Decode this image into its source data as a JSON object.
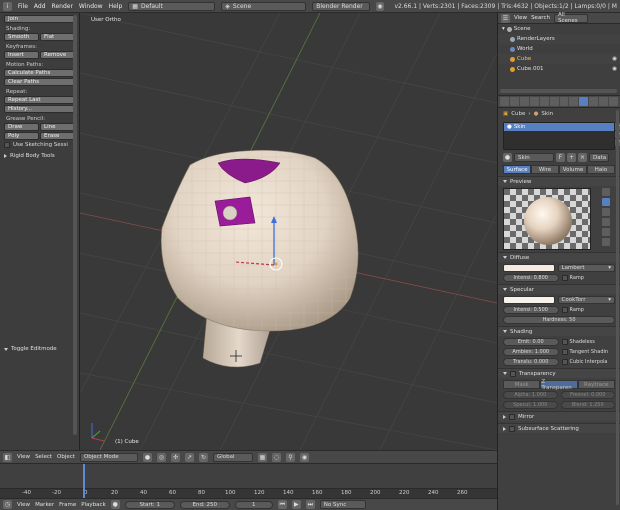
{
  "topbar": {
    "menus": [
      "File",
      "Add",
      "Render",
      "Window",
      "Help"
    ],
    "screen_layout": "Default",
    "scene": "Scene",
    "engine": "Blender Render",
    "stats": "v2.66.1 | Verts:2301 | Faces:2309 | Tris:4632 | Objects:1/2 | Lamps:0/0 | M"
  },
  "tools": {
    "join_label": "Join",
    "shading_title": "Shading:",
    "smooth_label": "Smooth",
    "flat_label": "Flat",
    "keyframes_title": "Keyframes:",
    "insert_label": "Insert",
    "remove_label": "Remove",
    "motion_title": "Motion Paths:",
    "calc_paths_label": "Calculate Paths",
    "clear_paths_label": "Clear Paths",
    "repeat_title": "Repeat:",
    "repeat_last_label": "Repeat Last",
    "history_label": "History...",
    "grease_title": "Grease Pencil:",
    "draw_label": "Draw",
    "line_label": "Line",
    "poly_label": "Poly",
    "erase_label": "Erase",
    "sketching_label": "Use Sketching Sessi",
    "rigid_body_label": "Rigid Body Tools",
    "toggle_editmode_label": "Toggle Editmode"
  },
  "viewport": {
    "view_label": "User Ortho",
    "object_label": "(1) Cube"
  },
  "vp_header": {
    "view": "View",
    "select": "Select",
    "object": "Object",
    "mode": "Object Mode",
    "orientation": "Global"
  },
  "timeline": {
    "ticks": [
      "-40",
      "-20",
      "0",
      "20",
      "40",
      "60",
      "80",
      "100",
      "120",
      "140",
      "160",
      "180",
      "200",
      "220",
      "240",
      "260"
    ],
    "header": {
      "view": "View",
      "marker": "Marker",
      "frame": "Frame",
      "playback": "Playback",
      "start": "Start: 1",
      "end": "End: 250",
      "current": "1",
      "sync": "No Sync"
    }
  },
  "outliner": {
    "view": "View",
    "search": "Search",
    "filter": "All Scenes",
    "rows": [
      "Scene",
      "RenderLayers",
      "World",
      "Cube",
      "Cube.001"
    ]
  },
  "properties": {
    "path_object": "Cube",
    "path_material": "Skin",
    "slot_name": "Skin",
    "material_name": "Skin",
    "material_users": "F",
    "data_label": "Data",
    "tabs": [
      "Surface",
      "Wire",
      "Volume",
      "Halo"
    ],
    "preview_title": "Preview",
    "diffuse": {
      "title": "Diffuse",
      "shader": "Lambert",
      "intensity": "Intensi: 0.800",
      "ramp": "Ramp",
      "color": "#f5ebe0"
    },
    "specular": {
      "title": "Specular",
      "shader": "CookTorr",
      "intensity": "Intensi: 0.500",
      "ramp": "Ramp",
      "hardness": "Hardness: 50",
      "color": "#f7f3ea"
    },
    "shading": {
      "title": "Shading",
      "emit": "Emit: 0.00",
      "ambient": "Ambien: 1.000",
      "translucency": "Translu: 0.000",
      "shadeless": "Shadeless",
      "tangent": "Tangent Shadin",
      "cubic": "Cubic Interpola"
    },
    "transparency": {
      "title": "Transparency",
      "modes": [
        "Mask",
        "Z Transparen",
        "Raytrace"
      ],
      "alpha": "Alpha: 1.000",
      "fresnel": "Fresnel: 0.000",
      "specular": "Specul: 1.000",
      "blend": "Blend: 1.250"
    },
    "mirror_title": "Mirror",
    "sss_title": "Subsurface Scattering"
  }
}
